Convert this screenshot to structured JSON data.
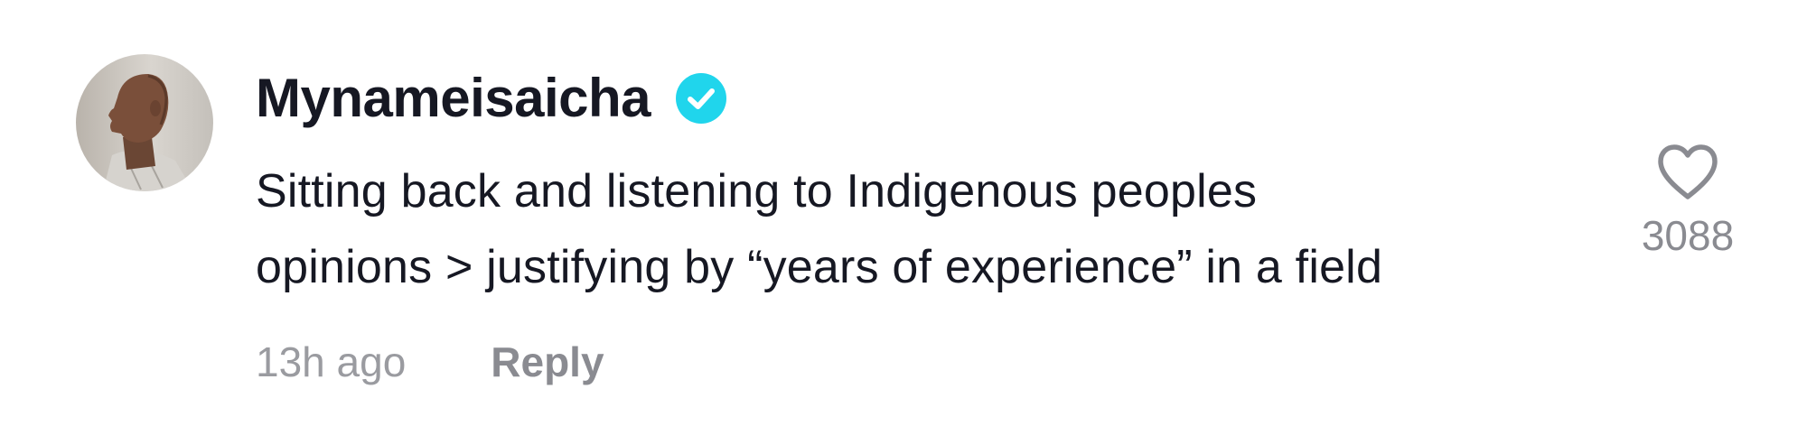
{
  "comment": {
    "author": {
      "username": "Mynameisaicha",
      "verified": true,
      "avatar_icon": "profile-photo"
    },
    "text_lines": [
      "Sitting back and listening to Indigenous peoples",
      "opinions > justifying by “years of experience” in a field"
    ],
    "timestamp": "13h ago",
    "reply_label": "Reply",
    "likes": {
      "count": "3088",
      "icon": "heart-outline-icon"
    }
  },
  "colors": {
    "text_primary": "#161823",
    "text_secondary": "#8a8b91",
    "verified_badge": "#20d5ec",
    "background": "#ffffff"
  }
}
